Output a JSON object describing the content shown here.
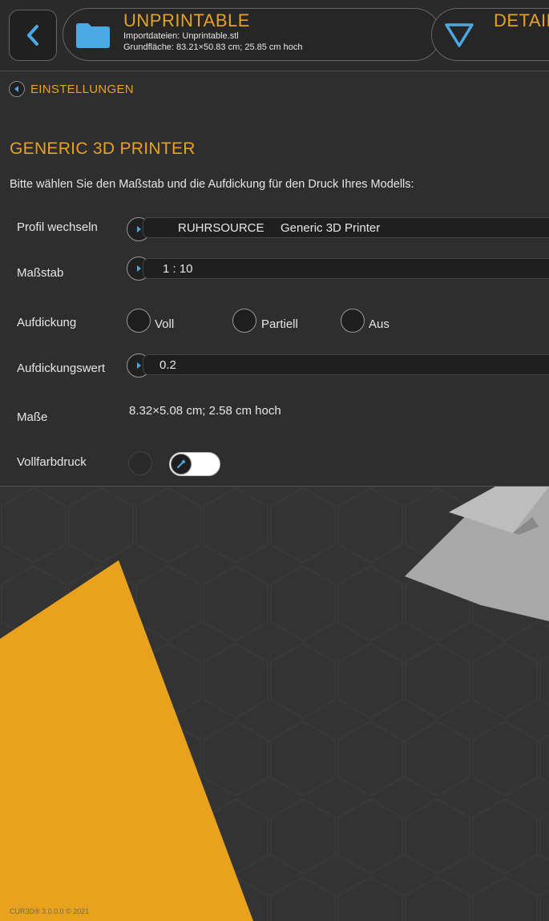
{
  "header": {
    "file_title": "UNPRINTABLE",
    "import_line": "Importdateien: Unprintable.stl",
    "base_line": "Grundfläche: 83.21×50.83 cm; 25.85 cm hoch",
    "detail_label": "DETAIL",
    "back_icon": "chevron-left-icon",
    "folder_icon": "folder-icon",
    "folder_color": "#4aa8e4",
    "detail_icon": "triangle-down-icon",
    "detail_icon_color": "#4aa8e4"
  },
  "breadcrumb": {
    "label": "EINSTELLUNGEN"
  },
  "printer": {
    "title": "GENERIC 3D PRINTER",
    "intro": "Bitte wählen Sie den Maßstab und die Aufdickung für den Druck Ihres Modells:"
  },
  "settings": {
    "profile": {
      "label": "Profil wechseln",
      "vendor": "RUHRSOURCE",
      "model": "Generic 3D Printer"
    },
    "scale": {
      "label": "Maßstab",
      "value": "1 : 10"
    },
    "thickening": {
      "label": "Aufdickung",
      "options": [
        "Voll",
        "Partiell",
        "Aus"
      ]
    },
    "thickening_value": {
      "label": "Aufdickungswert",
      "value": "0.2"
    },
    "dimensions": {
      "label": "Maße",
      "value": "8.32×5.08 cm; 2.58 cm hoch"
    },
    "full_color": {
      "label": "Vollfarbdruck",
      "toggle_on": true,
      "knob_icon": "eyedropper-icon"
    }
  },
  "viewport": {
    "model_color": "#e8a21e",
    "second_model_color": "#a9a9a9",
    "background": "#333333"
  },
  "footer": {
    "version": "CUR3D®  3.0.0.0  © 2021"
  },
  "colors": {
    "accent": "#e8a221",
    "icon_blue": "#4aa8e4",
    "panel": "#2e2e2e"
  }
}
